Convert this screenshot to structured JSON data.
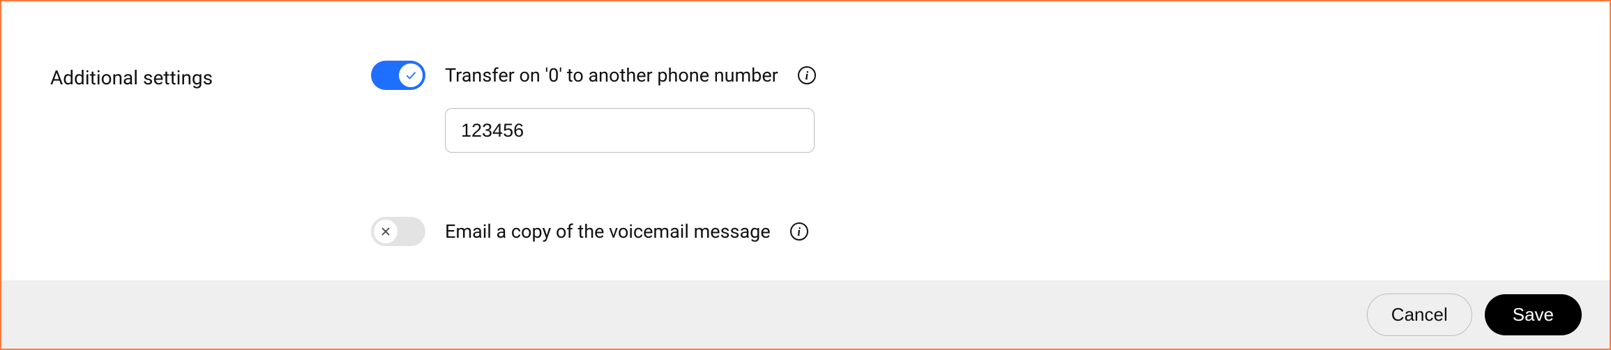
{
  "section_title": "Additional settings",
  "settings": {
    "transfer": {
      "label": "Transfer on '0' to another phone number",
      "value": "123456"
    },
    "email_copy": {
      "label": "Email a copy of the voicemail message"
    }
  },
  "footer": {
    "cancel": "Cancel",
    "save": "Save"
  }
}
